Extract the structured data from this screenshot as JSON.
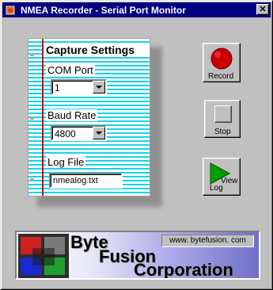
{
  "window": {
    "title": "NMEA Recorder - Serial Port Monitor",
    "close_glyph": "✕"
  },
  "capture": {
    "title": "Capture Settings",
    "com_port": {
      "label": "COM Port",
      "value": "1"
    },
    "baud_rate": {
      "label": "Baud Rate",
      "value": "4800"
    },
    "log_file": {
      "label": "Log File",
      "value": "nmealog.txt"
    }
  },
  "buttons": {
    "record": {
      "label": "Record",
      "icon": "record-icon",
      "color": "#cc0000"
    },
    "stop": {
      "label": "Stop",
      "icon": "stop-icon"
    },
    "view_log": {
      "label_view": "View",
      "label_log": "Log",
      "icon": "play-icon",
      "color": "#00a000"
    }
  },
  "banner": {
    "line1": "Byte",
    "line2": "Fusion",
    "line3": "Corporation",
    "url": "www. bytefusion. com",
    "logo_colors": [
      "#d02020",
      "#1a2ad0",
      "#20a030",
      "#7a7a7a"
    ]
  }
}
